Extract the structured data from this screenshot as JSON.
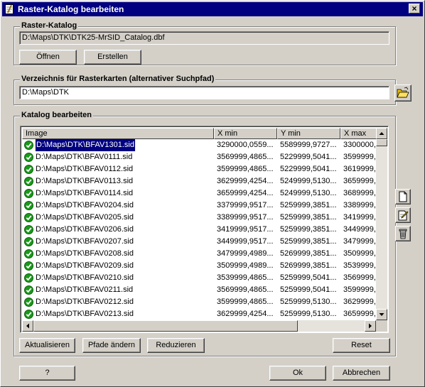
{
  "window": {
    "title": "Raster-Katalog bearbeiten",
    "close": "×"
  },
  "raster": {
    "label": "Raster-Katalog",
    "path": "D:\\Maps\\DTK\\DTK25-MrSID_Catalog.dbf",
    "open_label": "Öffnen",
    "create_label": "Erstellen"
  },
  "directory": {
    "label": "Verzeichnis für Rasterkarten (alternativer Suchpfad)",
    "path": "D:\\Maps\\DTK"
  },
  "catalog": {
    "label": "Katalog bearbeiten",
    "columns": [
      "Image",
      "X min",
      "Y min",
      "X max"
    ],
    "rows": [
      [
        "D:\\Maps\\DTK\\BFAV1301.sid",
        "3290000,0559...",
        "5589999,9727...",
        "3300000,..."
      ],
      [
        "D:\\Maps\\DTK\\BFAV0111.sid",
        "3569999,4865...",
        "5229999,5041...",
        "3599999,..."
      ],
      [
        "D:\\Maps\\DTK\\BFAV0112.sid",
        "3599999,4865...",
        "5229999,5041...",
        "3619999,..."
      ],
      [
        "D:\\Maps\\DTK\\BFAV0113.sid",
        "3629999,4254...",
        "5249999,5130...",
        "3659999,..."
      ],
      [
        "D:\\Maps\\DTK\\BFAV0114.sid",
        "3659999,4254...",
        "5249999,5130...",
        "3689999,..."
      ],
      [
        "D:\\Maps\\DTK\\BFAV0204.sid",
        "3379999,9517...",
        "5259999,3851...",
        "3389999,..."
      ],
      [
        "D:\\Maps\\DTK\\BFAV0205.sid",
        "3389999,9517...",
        "5259999,3851...",
        "3419999,..."
      ],
      [
        "D:\\Maps\\DTK\\BFAV0206.sid",
        "3419999,9517...",
        "5259999,3851...",
        "3449999,..."
      ],
      [
        "D:\\Maps\\DTK\\BFAV0207.sid",
        "3449999,9517...",
        "5259999,3851...",
        "3479999,..."
      ],
      [
        "D:\\Maps\\DTK\\BFAV0208.sid",
        "3479999,4989...",
        "5269999,3851...",
        "3509999,..."
      ],
      [
        "D:\\Maps\\DTK\\BFAV0209.sid",
        "3509999,4989...",
        "5269999,3851...",
        "3539999,..."
      ],
      [
        "D:\\Maps\\DTK\\BFAV0210.sid",
        "3539999,4865...",
        "5259999,5041...",
        "3569999,..."
      ],
      [
        "D:\\Maps\\DTK\\BFAV0211.sid",
        "3569999,4865...",
        "5259999,5041...",
        "3599999,..."
      ],
      [
        "D:\\Maps\\DTK\\BFAV0212.sid",
        "3599999,4865...",
        "5259999,5130...",
        "3629999,..."
      ],
      [
        "D:\\Maps\\DTK\\BFAV0213.sid",
        "3629999,4254...",
        "5259999,5130...",
        "3659999,..."
      ]
    ],
    "selected_row": 0
  },
  "bottom": {
    "refresh_label": "Aktualisieren",
    "change_paths_label": "Pfade ändern",
    "reduce_label": "Reduzieren",
    "reset_label": "Reset"
  },
  "dialog": {
    "help_label": "?",
    "ok_label": "Ok",
    "cancel_label": "Abbrechen"
  },
  "icons": {
    "folder": "open-folder-icon",
    "new": "new-document-icon",
    "edit": "edit-document-icon",
    "delete": "trash-icon",
    "check": "green-check-icon"
  }
}
